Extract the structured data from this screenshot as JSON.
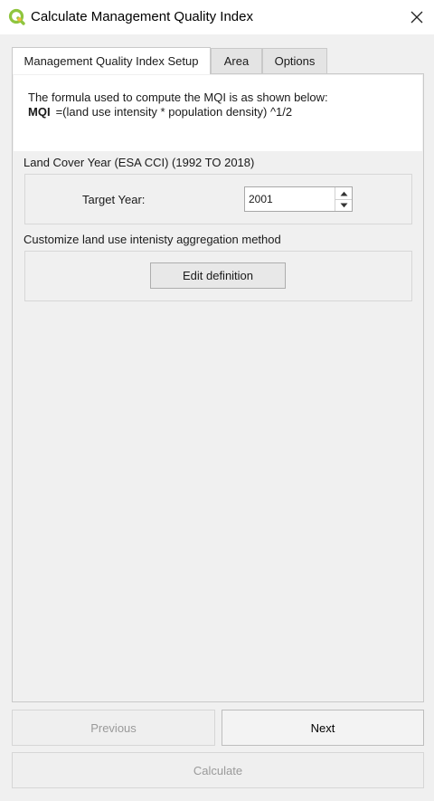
{
  "window": {
    "title": "Calculate Management Quality Index",
    "icon": "qgis-logo-icon",
    "close_icon": "close-icon"
  },
  "tabs": [
    {
      "label": "Management Quality Index Setup",
      "active": true
    },
    {
      "label": "Area",
      "active": false
    },
    {
      "label": "Options",
      "active": false
    }
  ],
  "formula": {
    "intro": "The formula used to compute the MQI is as shown below:",
    "name": "MQI",
    "expression": "=(land use intensity * population density) ^1/2"
  },
  "land_cover": {
    "section_label": "Land Cover Year (ESA CCI) (1992 TO 2018)",
    "target_year_label": "Target Year:",
    "target_year_value": "2001"
  },
  "aggregation": {
    "section_label": "Customize land use intenisty aggregation method",
    "edit_button_label": "Edit definition"
  },
  "footer": {
    "previous_label": "Previous",
    "next_label": "Next",
    "calculate_label": "Calculate"
  },
  "colors": {
    "accent_green": "#8fc53e",
    "window_bg": "#f0f0f0",
    "disabled_text": "#9a9a9a"
  }
}
